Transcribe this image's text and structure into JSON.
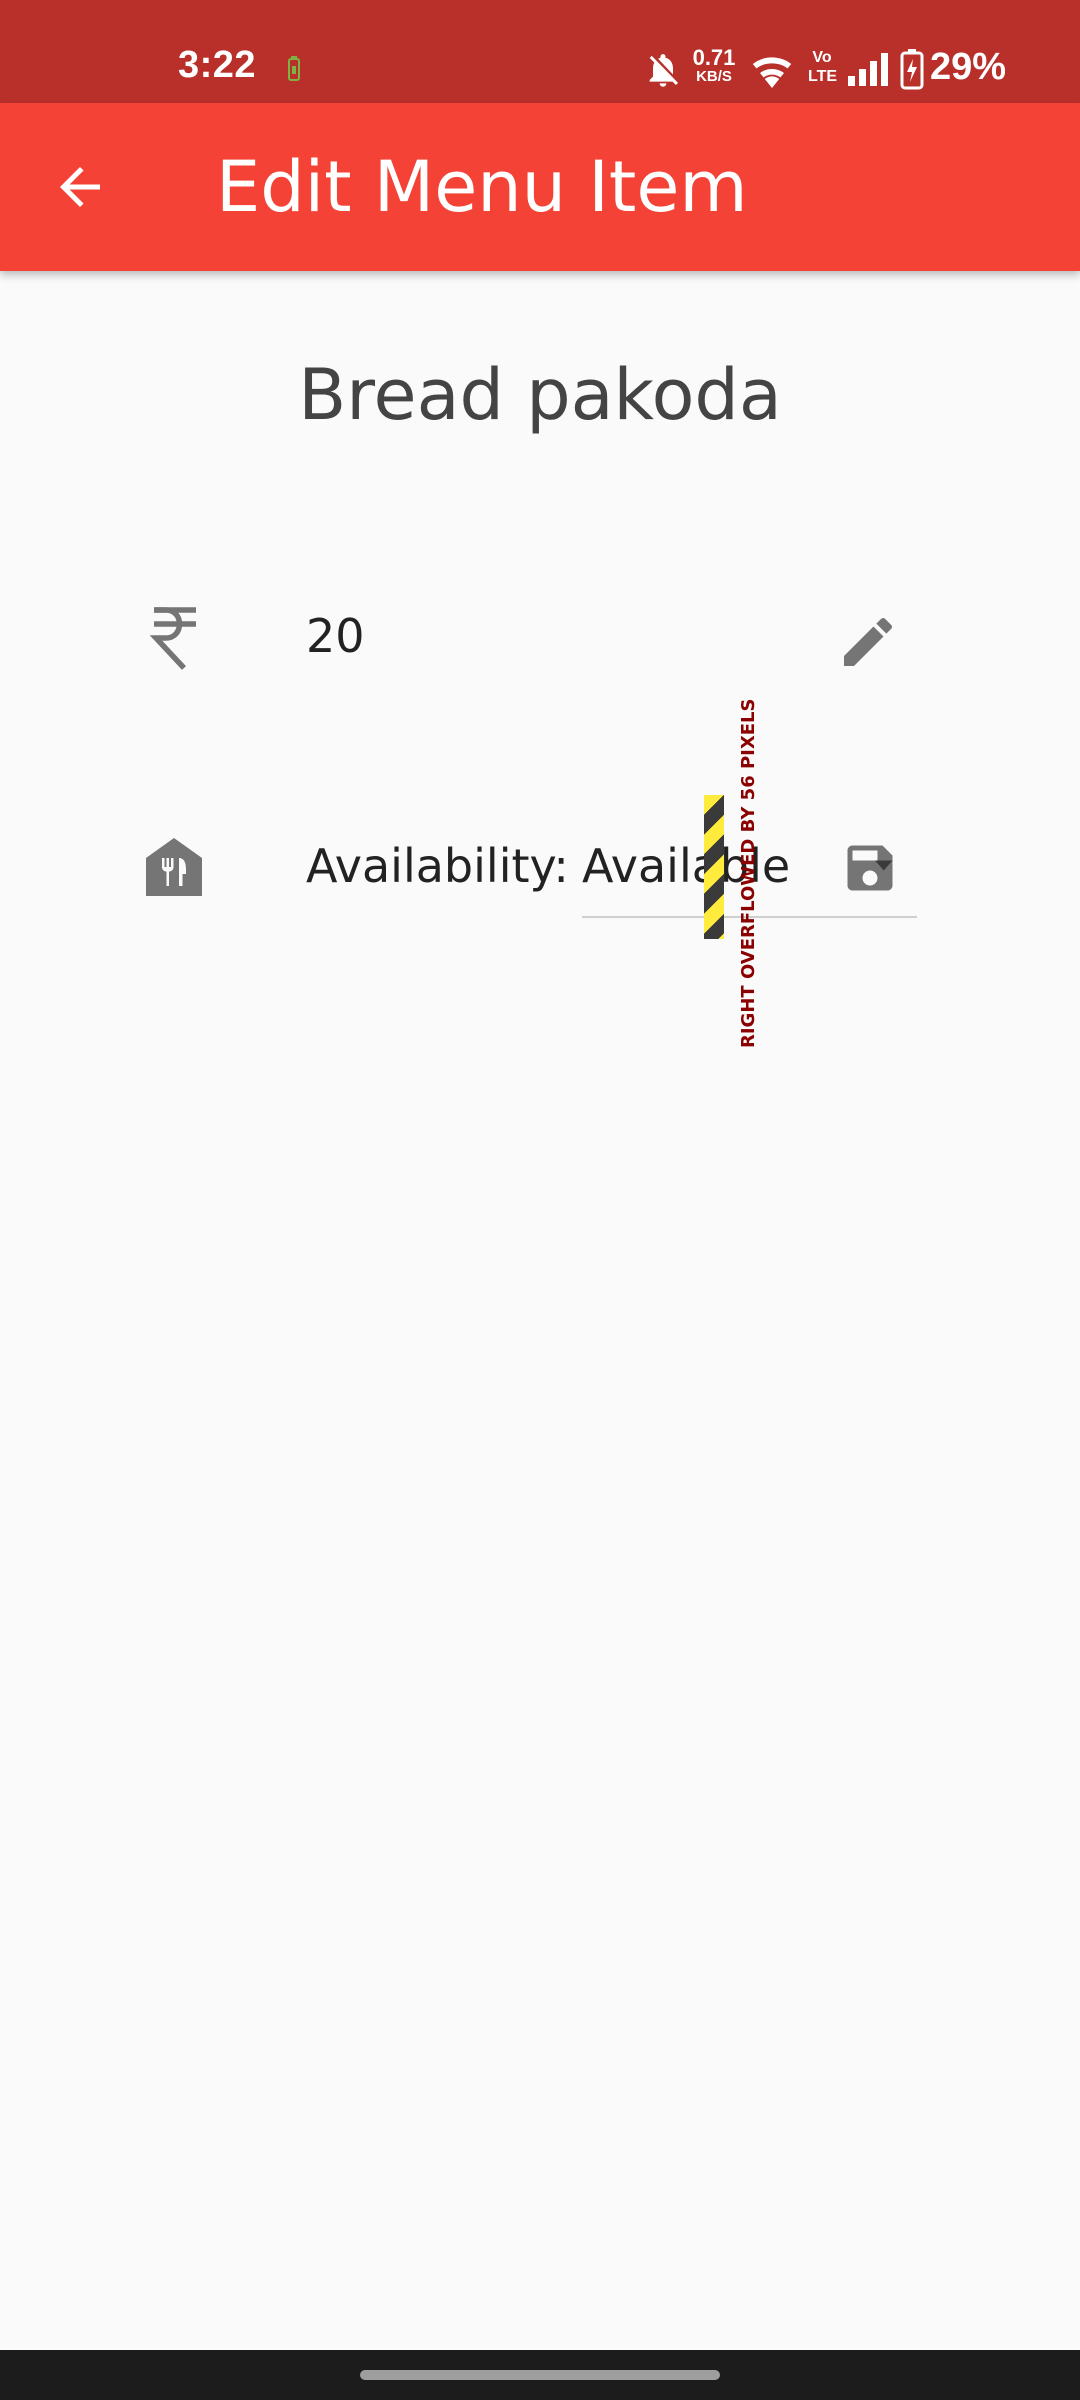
{
  "status_bar": {
    "time": "3:22",
    "net_speed_value": "0.71",
    "net_speed_unit": "KB/S",
    "volte": "Vo\nLTE",
    "volte_top": "Vo",
    "volte_bottom": "LTE",
    "battery_percent": "29%",
    "icons": [
      "battery-saver-icon",
      "mute-icon",
      "wifi-icon",
      "signal-icon",
      "battery-charging-icon"
    ]
  },
  "app_bar": {
    "title": "Edit Menu Item",
    "back_icon": "arrow-back-icon",
    "color": "#f44336"
  },
  "item": {
    "name": "Bread pakoda",
    "price": "20",
    "price_icon": "rupee-icon",
    "availability_label": "Availability:",
    "availability_value": "Available",
    "availability_icon": "restaurant-store-icon"
  },
  "overflow_warning": {
    "text": "RIGHT OVERFLOWED BY 56 PIXELS"
  },
  "colors": {
    "status_bar": "#b9302a",
    "app_bar": "#f44336",
    "background": "#fafafa",
    "icon_grey": "#757575"
  }
}
